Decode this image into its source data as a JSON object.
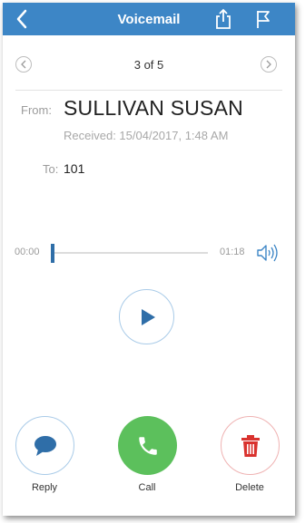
{
  "header": {
    "title": "Voicemail",
    "back_icon": "chevron-left-icon",
    "share_icon": "share-icon",
    "flag_icon": "flag-icon",
    "background": "#3d86c6"
  },
  "navigation": {
    "counter": "3 of 5",
    "prev_icon": "chevron-left-circle-icon",
    "next_icon": "chevron-right-circle-icon"
  },
  "message": {
    "from_label": "From:",
    "from_name": "SULLIVAN SUSAN",
    "received": "Received: 15/04/2017, 1:48 AM",
    "to_label": "To:",
    "to_value": "101"
  },
  "player": {
    "current_time": "00:00",
    "duration": "01:18",
    "progress": 0,
    "speaker_icon": "speaker-icon",
    "play_icon": "play-icon"
  },
  "actions": {
    "reply_label": "Reply",
    "call_label": "Call",
    "delete_label": "Delete",
    "reply_color": "#2f6ea8",
    "call_color": "#5cc05c",
    "delete_color": "#d9322e"
  }
}
